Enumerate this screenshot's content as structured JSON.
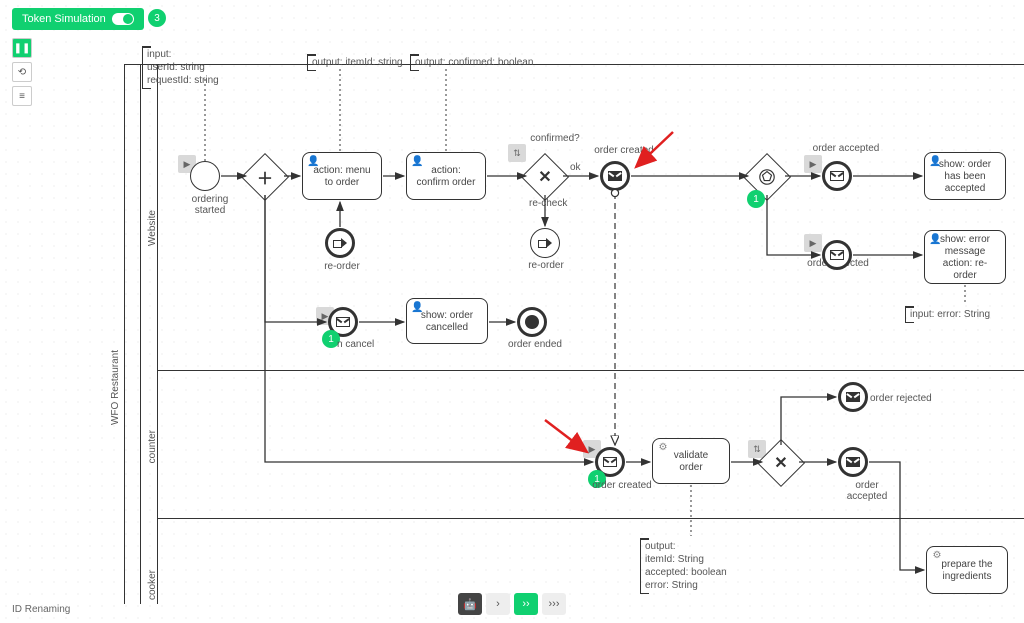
{
  "toolbar": {
    "sim_label": "Token Simulation",
    "count": "3",
    "id_renaming": "ID Renaming"
  },
  "pool": {
    "name": "WFO Restaurant"
  },
  "lanes": {
    "website": "Website",
    "counter": "counter",
    "cooker": "cooker"
  },
  "annotations": {
    "input_top": "input:\nuserId: string\nrequestId: string",
    "output_item": "output: itemId: string",
    "output_confirmed": "output: confirmed: boolean",
    "input_error": "input: error: String",
    "output_validate": "output:\nitemId: String\naccepted: boolean\nerror: String"
  },
  "events": {
    "start": "ordering started",
    "reorder_throw": "re-order",
    "reorder_catch": "re-order",
    "order_created_w": "order created",
    "order_accepted_w": "order accepted",
    "order_rejected_w": "order rejected",
    "on_cancel": "n cancel",
    "order_ended": "order ended",
    "order_created_c": "order created",
    "order_rejected_c": "order rejected",
    "order_accepted_c": "order accepted"
  },
  "gateways": {
    "confirmed_q": "confirmed?",
    "ok": "ok",
    "recheck": "re-check"
  },
  "tasks": {
    "menu_to_order": "action: menu to order",
    "confirm_order": "action: confirm order",
    "show_accepted": "show: order has been accepted",
    "show_error": "show: error message\naction: re-order",
    "show_cancelled": "show: order cancelled",
    "validate_order": "validate order",
    "prepare": "prepare the ingredients"
  },
  "tokens": {
    "one": "1"
  },
  "bottom_nav": {
    "next": "›",
    "ff": "››",
    "fff": "›››"
  }
}
